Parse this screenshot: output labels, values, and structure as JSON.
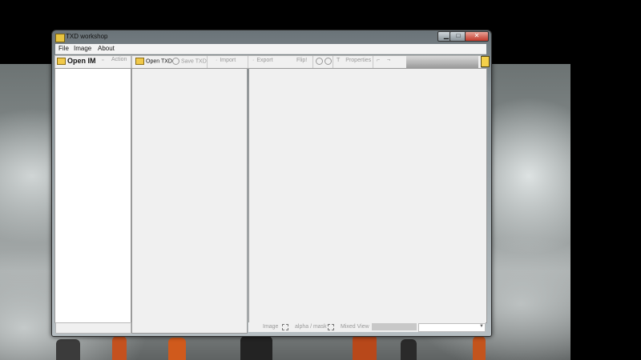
{
  "window": {
    "title": "TXD workshop"
  },
  "controls": {
    "minimize": "▁",
    "maximize": "□",
    "close": "✕"
  },
  "menu": {
    "file": "File",
    "image": "Image",
    "about": "About"
  },
  "left_toolbar": {
    "open_img": "Open IMG",
    "action": "Action"
  },
  "toolbar": {
    "open_txd": "Open TXD",
    "save_txd": "Save TXD",
    "import": "Import",
    "export": "Export",
    "flip": "Flip!",
    "properties": "Properties",
    "properties_icon_glyph": "T"
  },
  "statusbar": {
    "image": "Image",
    "alpha_mask": "alpha / mask",
    "mixed_view": "Mixed View",
    "combo_value": ""
  },
  "icons": {
    "app": "txd-app-icon",
    "folder": "folder-icon",
    "save": "save-icon",
    "zoom_in": "zoom-in-icon",
    "zoom_out": "zoom-out-icon",
    "notepad": "notepad-icon"
  },
  "colors": {
    "folder": "#f1c94a",
    "close": "#c2392a",
    "window_frame": "#8d979c"
  }
}
